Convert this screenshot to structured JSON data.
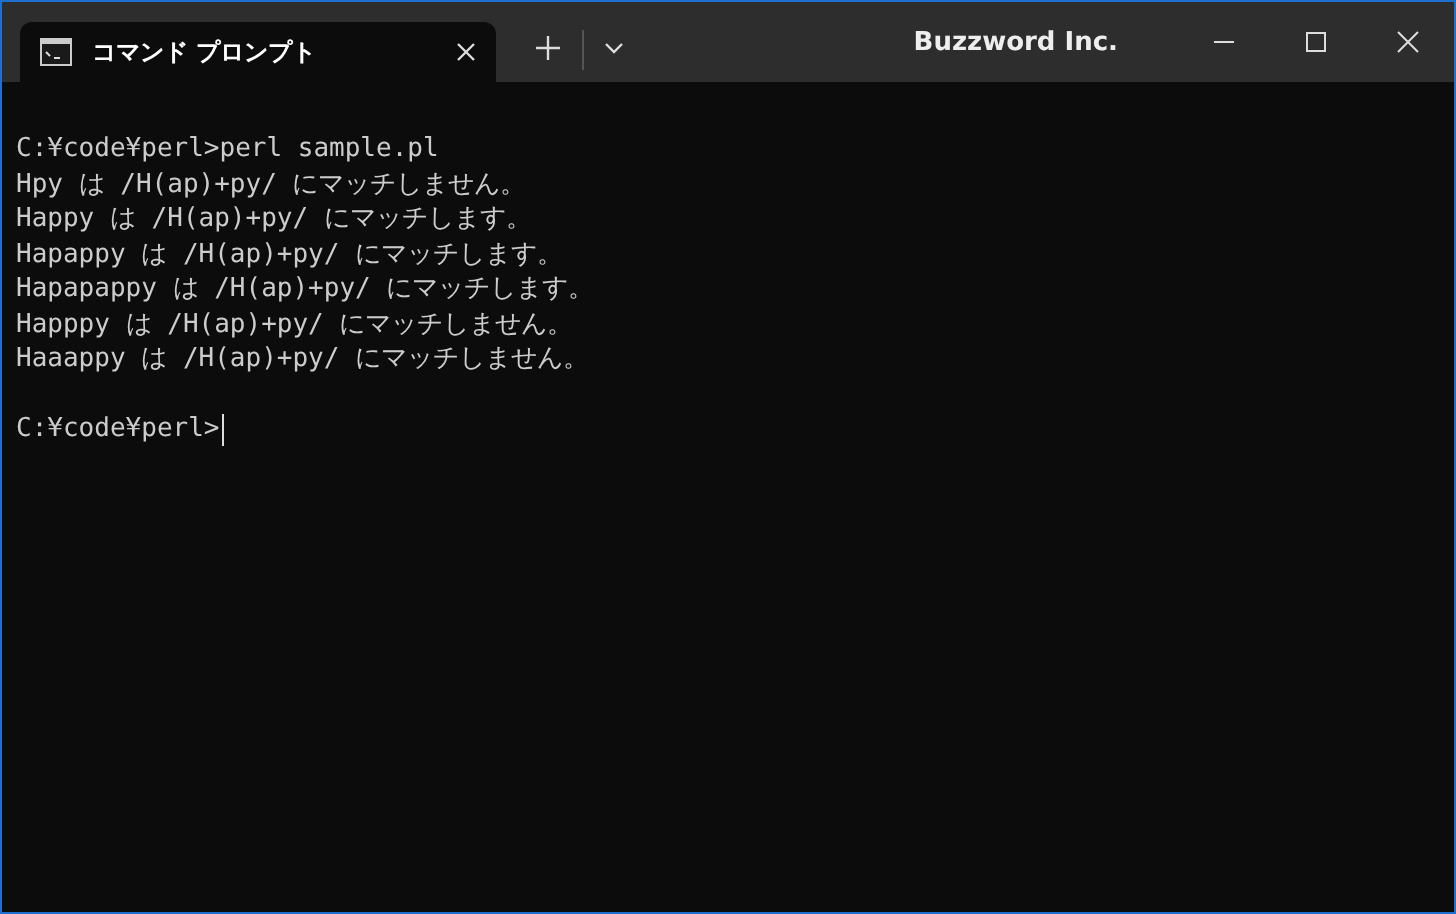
{
  "window": {
    "app_name": "Buzzword Inc."
  },
  "tabs": [
    {
      "label": "コマンド プロンプト",
      "selected": true
    }
  ],
  "terminal": {
    "lines": [
      "C:¥code¥perl>perl sample.pl",
      "Hpy は /H(ap)+py/ にマッチしません。",
      "Happy は /H(ap)+py/ にマッチします。",
      "Hapappy は /H(ap)+py/ にマッチします。",
      "Hapapappy は /H(ap)+py/ にマッチします。",
      "Happpy は /H(ap)+py/ にマッチしません。",
      "Haaappy は /H(ap)+py/ にマッチしません。"
    ],
    "prompt": "C:¥code¥perl>"
  }
}
